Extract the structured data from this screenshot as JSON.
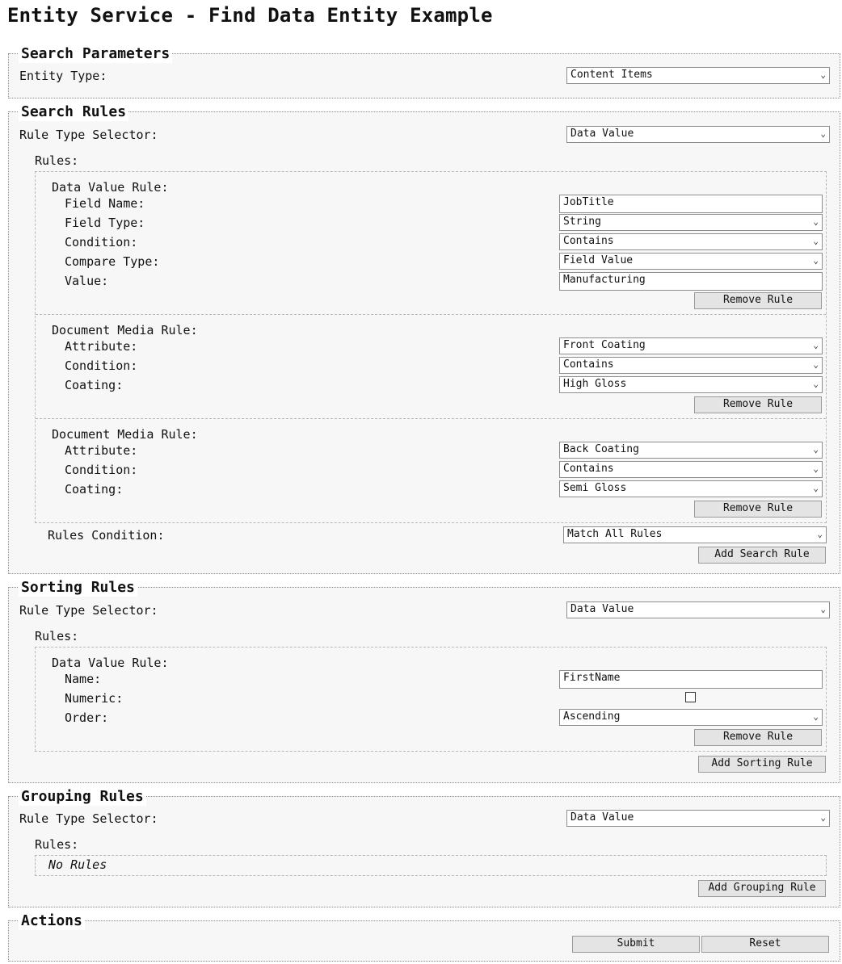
{
  "page_title": "Entity Service - Find Data Entity Example",
  "search_parameters": {
    "legend": "Search Parameters",
    "entity_type_label": "Entity Type:",
    "entity_type_value": "Content Items"
  },
  "search_rules": {
    "legend": "Search Rules",
    "rule_type_label": "Rule Type Selector:",
    "rule_type_value": "Data Value",
    "rules_label": "Rules:",
    "data_value_rule": {
      "heading": "Data Value Rule:",
      "field_name_label": "Field Name:",
      "field_name_value": "JobTitle",
      "field_type_label": "Field Type:",
      "field_type_value": "String",
      "condition_label": "Condition:",
      "condition_value": "Contains",
      "compare_type_label": "Compare Type:",
      "compare_type_value": "Field Value",
      "value_label": "Value:",
      "value_value": "Manufacturing",
      "remove_label": "Remove Rule"
    },
    "doc_media_rule_1": {
      "heading": "Document Media Rule:",
      "attribute_label": "Attribute:",
      "attribute_value": "Front Coating",
      "condition_label": "Condition:",
      "condition_value": "Contains",
      "coating_label": "Coating:",
      "coating_value": "High Gloss",
      "remove_label": "Remove Rule"
    },
    "doc_media_rule_2": {
      "heading": "Document Media Rule:",
      "attribute_label": "Attribute:",
      "attribute_value": "Back Coating",
      "condition_label": "Condition:",
      "condition_value": "Contains",
      "coating_label": "Coating:",
      "coating_value": "Semi Gloss",
      "remove_label": "Remove Rule"
    },
    "rules_condition_label": "Rules Condition:",
    "rules_condition_value": "Match All Rules",
    "add_label": "Add Search Rule"
  },
  "sorting_rules": {
    "legend": "Sorting Rules",
    "rule_type_label": "Rule Type Selector:",
    "rule_type_value": "Data Value",
    "rules_label": "Rules:",
    "data_value_rule": {
      "heading": "Data Value Rule:",
      "name_label": "Name:",
      "name_value": "FirstName",
      "numeric_label": "Numeric:",
      "numeric_checked": false,
      "order_label": "Order:",
      "order_value": "Ascending",
      "remove_label": "Remove Rule"
    },
    "add_label": "Add Sorting Rule"
  },
  "grouping_rules": {
    "legend": "Grouping Rules",
    "rule_type_label": "Rule Type Selector:",
    "rule_type_value": "Data Value",
    "rules_label": "Rules:",
    "empty_text": "No Rules",
    "add_label": "Add Grouping Rule"
  },
  "actions": {
    "legend": "Actions",
    "submit_label": "Submit",
    "reset_label": "Reset"
  }
}
